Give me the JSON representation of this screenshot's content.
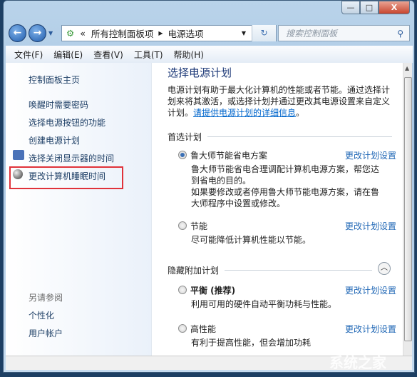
{
  "window": {
    "controls": {
      "minimize": "—",
      "maximize": "□",
      "close": "X"
    }
  },
  "nav": {
    "back": "←",
    "forward": "→",
    "breadcrumb": [
      "所有控制面板项",
      "电源选项"
    ],
    "breadcrumb_prefix": "«",
    "search_placeholder": "搜索控制面板",
    "icons": [
      "back-icon",
      "forward-icon",
      "control-panel-icon",
      "refresh-icon",
      "search-icon"
    ]
  },
  "menu": [
    "文件(F)",
    "编辑(E)",
    "查看(V)",
    "工具(T)",
    "帮助(H)"
  ],
  "sidebar": {
    "home": "控制面板主页",
    "items": [
      "唤醒时需要密码",
      "选择电源按钮的功能",
      "创建电源计划",
      "选择关闭显示器的时间",
      "更改计算机睡眠时间"
    ],
    "see_also_title": "另请参阅",
    "see_also": [
      "个性化",
      "用户帐户"
    ],
    "highlight_color": "#e0323a"
  },
  "main": {
    "title": "选择电源计划",
    "description": "电源计划有助于最大化计算机的性能或者节能。通过选择计划来将其激活，或选择计划并通过更改其电源设置来自定义计划。",
    "details_link": "请提供电源计划的详细信息",
    "details_suffix": "。",
    "preferred_title": "首选计划",
    "hidden_title": "隐藏附加计划",
    "change_link": "更改计划设置",
    "plans": [
      {
        "name": "鲁大师节能省电方案",
        "selected": true,
        "desc": "鲁大师节能省电合理调配计算机电源方案，帮您达到省电的目的。",
        "desc2": "如果要修改或者停用鲁大师节能电源方案，请在鲁大师程序中设置或修改。"
      },
      {
        "name": "节能",
        "selected": false,
        "desc": "尽可能降低计算机性能以节能。"
      },
      {
        "name": "平衡 (推荐)",
        "selected": false,
        "desc": "利用可用的硬件自动平衡功耗与性能。"
      },
      {
        "name": "高性能",
        "selected": false,
        "desc": "有利于提高性能，但会增加功耗"
      }
    ]
  },
  "watermark": "系统之家"
}
